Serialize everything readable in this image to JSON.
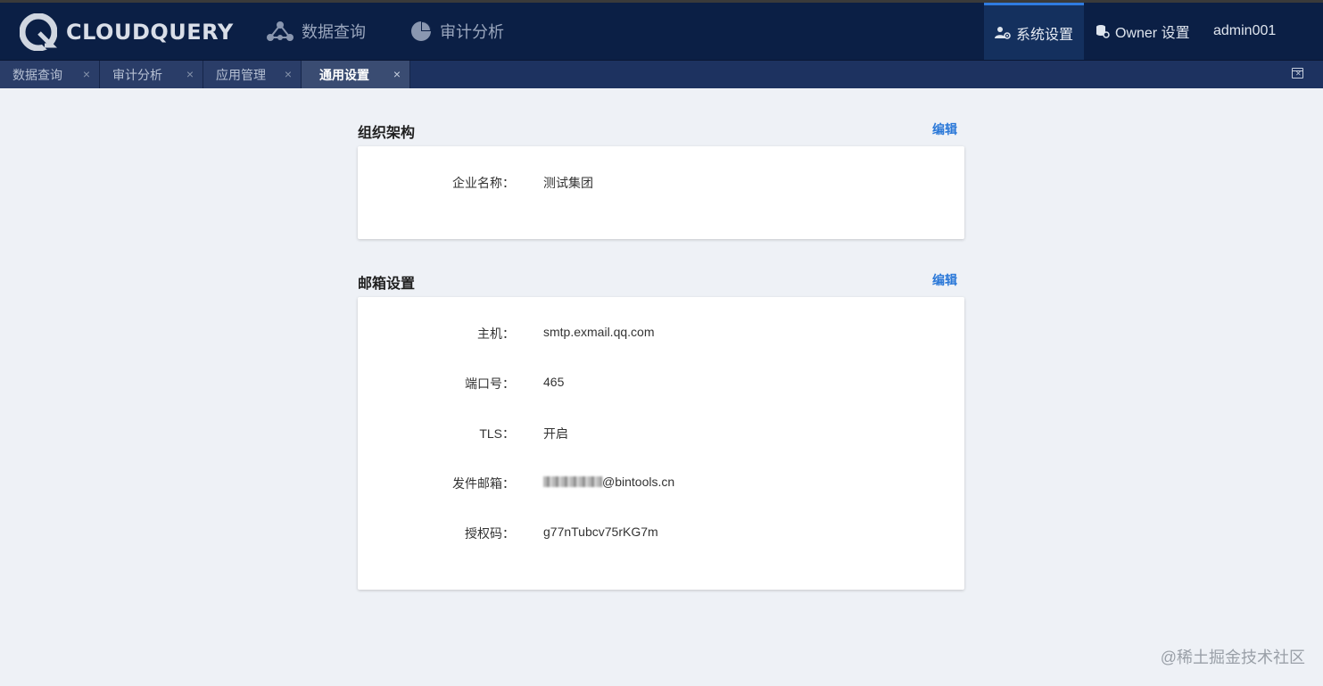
{
  "header": {
    "logo_text": "CLOUDQUERY",
    "nav": [
      {
        "label": "数据查询",
        "icon": "network-icon"
      },
      {
        "label": "审计分析",
        "icon": "pie-chart-icon"
      }
    ],
    "system_settings": "系统设置",
    "owner_settings": "Owner 设置",
    "user": "admin001"
  },
  "tabs": [
    {
      "label": "数据查询"
    },
    {
      "label": "审计分析"
    },
    {
      "label": "应用管理"
    },
    {
      "label": "通用设置",
      "active": true
    }
  ],
  "tab_close": "×",
  "org": {
    "title": "组织架构",
    "edit": "编辑",
    "fields": [
      {
        "label": "企业名称：",
        "value": "测试集团"
      }
    ]
  },
  "mail": {
    "title": "邮箱设置",
    "edit": "编辑",
    "fields": [
      {
        "label": "主机：",
        "value": "smtp.exmail.qq.com"
      },
      {
        "label": "端口号：",
        "value": "465"
      },
      {
        "label": "TLS：",
        "value": "开启"
      },
      {
        "label": "发件邮箱：",
        "value": "@bintools.cn"
      },
      {
        "label": "授权码：",
        "value": "g77nTubcv75rKG7m"
      }
    ]
  },
  "watermark": "@稀土掘金技术社区",
  "colors": {
    "header_bg": "#0b1f45",
    "tab_bg": "#1d3260",
    "accent": "#2a78d8",
    "page_bg": "#eef1f6"
  }
}
